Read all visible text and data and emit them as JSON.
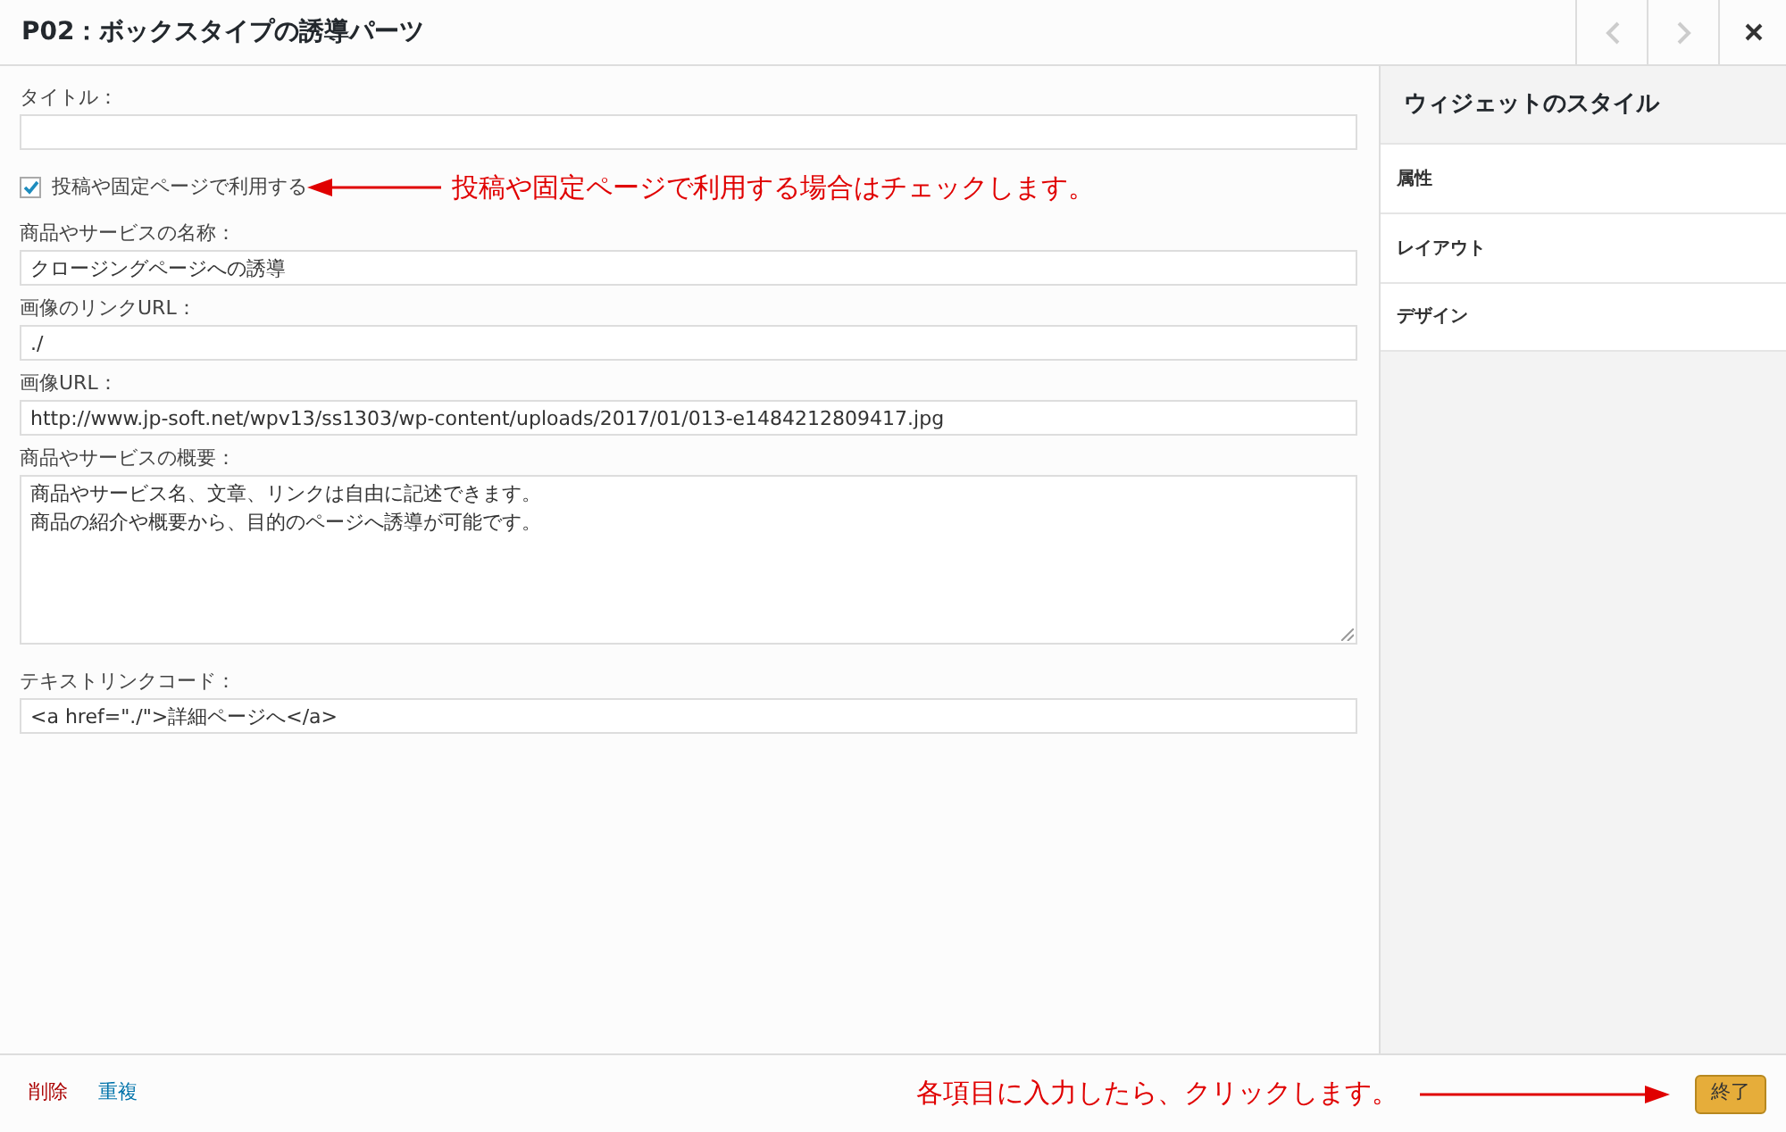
{
  "window": {
    "title": "P02：ボックスタイプの誘導パーツ"
  },
  "nav": {
    "prev_disabled": true,
    "next_disabled": true
  },
  "fields": [
    {
      "kind": "text",
      "label": "タイトル："
    },
    {
      "kind": "checkbox",
      "label": "投稿や固定ページで利用する",
      "checked": true,
      "annotation": "投稿や固定ページで利用する場合はチェックします。"
    },
    {
      "kind": "text",
      "label": "商品やサービスの名称：",
      "value": "クロージングページへの誘導"
    },
    {
      "kind": "text",
      "label": "画像のリンクURL：",
      "value": "./"
    },
    {
      "kind": "text",
      "label": "画像URL：",
      "value": "http://www.jp-soft.net/wpv13/ss1303/wp-content/uploads/2017/01/013-e1484212809417.jpg"
    },
    {
      "kind": "textarea",
      "label": "商品やサービスの概要：",
      "lines": [
        "商品やサービス名、文章、リンクは自由に記述できます。",
        "商品の紹介や概要から、目的のページへ誘導が可能です。"
      ]
    },
    {
      "kind": "text",
      "label": "テキストリンクコード：",
      "value": "<a href=\"./\">詳細ページへ</a>"
    }
  ],
  "sidebar": {
    "title": "ウィジェットのスタイル",
    "items": [
      {
        "label": "属性"
      },
      {
        "label": "レイアウト"
      },
      {
        "label": "デザイン"
      }
    ]
  },
  "footer": {
    "delete": "削除",
    "duplicate": "重複",
    "annotation": "各項目に入力したら、クリックします。",
    "done": "終了"
  }
}
